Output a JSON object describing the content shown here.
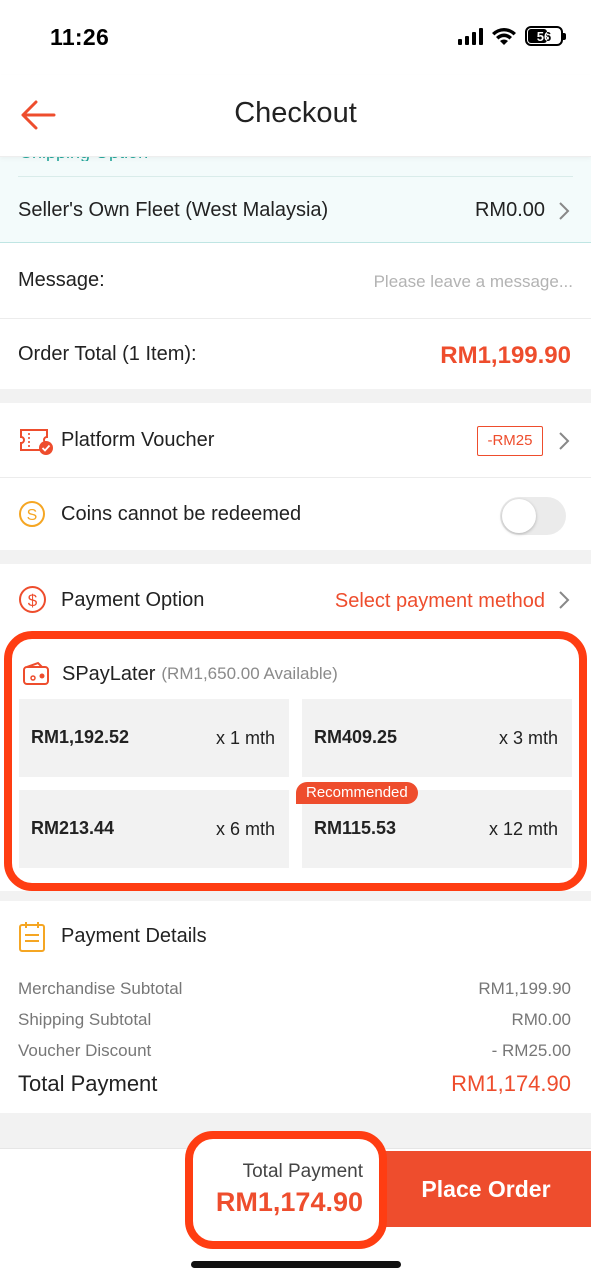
{
  "status_bar": {
    "time": "11:26",
    "battery": "56"
  },
  "header": {
    "title": "Checkout"
  },
  "shipping": {
    "partial_text": "Shipping Option",
    "method": "Seller's Own Fleet (West Malaysia)",
    "fee": "RM0.00"
  },
  "message": {
    "label": "Message:",
    "placeholder": "Please leave a message..."
  },
  "order_total": {
    "label": "Order Total (1 Item):",
    "value": "RM1,199.90"
  },
  "voucher": {
    "label": "Platform Voucher",
    "tag": "-RM25",
    "icon": "voucher-icon"
  },
  "coins": {
    "label": "Coins cannot be redeemed",
    "icon": "coin-icon",
    "enabled": false
  },
  "payment_option": {
    "label": "Payment Option",
    "value": "Select payment method",
    "icon": "dollar-icon"
  },
  "spaylater": {
    "name": "SPayLater",
    "available": "(RM1,650.00 Available)",
    "badge": "Recommended",
    "plans": [
      {
        "amount": "RM1,192.52",
        "term": "x 1 mth"
      },
      {
        "amount": "RM409.25",
        "term": "x 3 mth"
      },
      {
        "amount": "RM213.44",
        "term": "x 6 mth"
      },
      {
        "amount": "RM115.53",
        "term": "x 12 mth"
      }
    ]
  },
  "payment_details": {
    "title": "Payment Details",
    "rows": [
      {
        "label": "Merchandise Subtotal",
        "value": "RM1,199.90"
      },
      {
        "label": "Shipping Subtotal",
        "value": "RM0.00"
      },
      {
        "label": "Voucher Discount",
        "value": "- RM25.00"
      }
    ],
    "total_label": "Total Payment",
    "total_value": "RM1,174.90"
  },
  "bottom_bar": {
    "total_label": "Total Payment",
    "total_value": "RM1,174.90",
    "place_order": "Place Order"
  },
  "colors": {
    "accent": "#ee4d2d",
    "highlight": "#ff3d12",
    "teal": "#23a69a"
  }
}
